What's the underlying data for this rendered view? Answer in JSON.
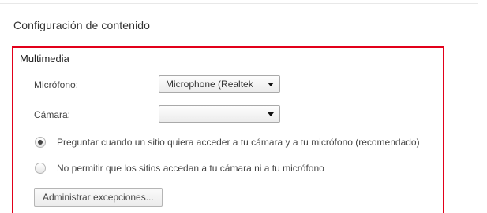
{
  "dialog": {
    "title": "Configuración de contenido"
  },
  "multimedia": {
    "title": "Multimedia",
    "microphone": {
      "label": "Micrófono:",
      "selected": "Microphone (Realtek"
    },
    "camera": {
      "label": "Cámara:",
      "selected": ""
    },
    "options": [
      {
        "label": "Preguntar cuando un sitio quiera acceder a tu cámara y a tu micrófono (recomendado)",
        "checked": true
      },
      {
        "label": "No permitir que los sitios accedan a tu cámara ni a tu micrófono",
        "checked": false
      }
    ],
    "manage_button": "Administrar excepciones...",
    "accent_color": "#e2001a"
  },
  "icons": {
    "dropdown": "chevron-down-icon"
  }
}
